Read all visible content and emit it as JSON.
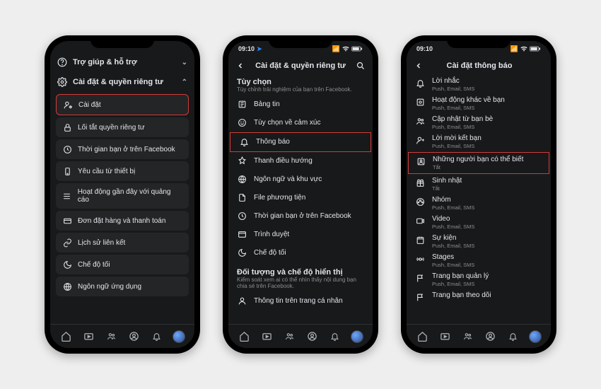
{
  "colors": {
    "highlight": "#d43a3a",
    "bg": "#18191a",
    "card": "#242526",
    "text": "#e4e6eb",
    "muted": "#8a8d91"
  },
  "phone1": {
    "help_support": "Trợ giúp & hỗ trợ",
    "settings_privacy": "Cài đặt & quyền riêng tư",
    "items": [
      {
        "icon": "user-gear",
        "label": "Cài đặt",
        "highlight": true
      },
      {
        "icon": "lock",
        "label": "Lối tắt quyền riêng tư"
      },
      {
        "icon": "clock",
        "label": "Thời gian bạn ở trên Facebook"
      },
      {
        "icon": "device",
        "label": "Yêu cầu từ thiết bị"
      },
      {
        "icon": "list",
        "label": "Hoạt động gần đây với quảng cáo"
      },
      {
        "icon": "card",
        "label": "Đơn đặt hàng và thanh toán"
      },
      {
        "icon": "link",
        "label": "Lịch sử liên kết"
      },
      {
        "icon": "moon",
        "label": "Chế độ tối"
      },
      {
        "icon": "globe",
        "label": "Ngôn ngữ ứng dụng"
      }
    ]
  },
  "phone2": {
    "time": "09:10",
    "header": "Cài đặt & quyền riêng tư",
    "section1_title": "Tùy chọn",
    "section1_sub": "Tùy chỉnh trải nghiệm của bạn trên Facebook.",
    "items1": [
      {
        "icon": "feed",
        "label": "Bảng tin"
      },
      {
        "icon": "react",
        "label": "Tùy chọn về cảm xúc"
      },
      {
        "icon": "bell",
        "label": "Thông báo",
        "highlight": true
      },
      {
        "icon": "pin",
        "label": "Thanh điều hướng"
      },
      {
        "icon": "globe",
        "label": "Ngôn ngữ và khu vực"
      },
      {
        "icon": "file",
        "label": "File phương tiện"
      },
      {
        "icon": "clock",
        "label": "Thời gian bạn ở trên Facebook"
      },
      {
        "icon": "browser",
        "label": "Trình duyệt"
      },
      {
        "icon": "moon",
        "label": "Chế độ tối"
      }
    ],
    "section2_title": "Đối tượng và chế độ hiển thị",
    "section2_sub": "Kiểm soát xem ai có thể nhìn thấy nội dung bạn chia sẻ trên Facebook.",
    "items2": [
      {
        "icon": "user",
        "label": "Thông tin trên trang cá nhân"
      }
    ]
  },
  "phone3": {
    "time": "09:10",
    "header": "Cài đặt thông báo",
    "items": [
      {
        "icon": "bell",
        "label": "Lời nhắc",
        "sub": "Push, Email, SMS"
      },
      {
        "icon": "activity",
        "label": "Hoạt động khác về bạn",
        "sub": "Push, Email, SMS"
      },
      {
        "icon": "friends",
        "label": "Cập nhật từ bạn bè",
        "sub": "Push, Email, SMS"
      },
      {
        "icon": "addfriend",
        "label": "Lời mời kết bạn",
        "sub": "Push, Email, SMS"
      },
      {
        "icon": "people",
        "label": "Những người bạn có thể biết",
        "sub": "Tắt",
        "highlight": true
      },
      {
        "icon": "gift",
        "label": "Sinh nhật",
        "sub": "Tắt"
      },
      {
        "icon": "group",
        "label": "Nhóm",
        "sub": "Push, Email, SMS"
      },
      {
        "icon": "video",
        "label": "Video",
        "sub": "Push, Email, SMS"
      },
      {
        "icon": "calendar",
        "label": "Sự kiện",
        "sub": "Push, Email, SMS"
      },
      {
        "icon": "stages",
        "label": "Stages",
        "sub": "Push, Email, SMS"
      },
      {
        "icon": "flag",
        "label": "Trang bạn quản lý",
        "sub": "Push, Email, SMS"
      },
      {
        "icon": "flag",
        "label": "Trang bạn theo dõi",
        "sub": ""
      }
    ]
  },
  "bottom_nav": [
    "home",
    "watch",
    "friends",
    "profile",
    "bell",
    "menu"
  ]
}
